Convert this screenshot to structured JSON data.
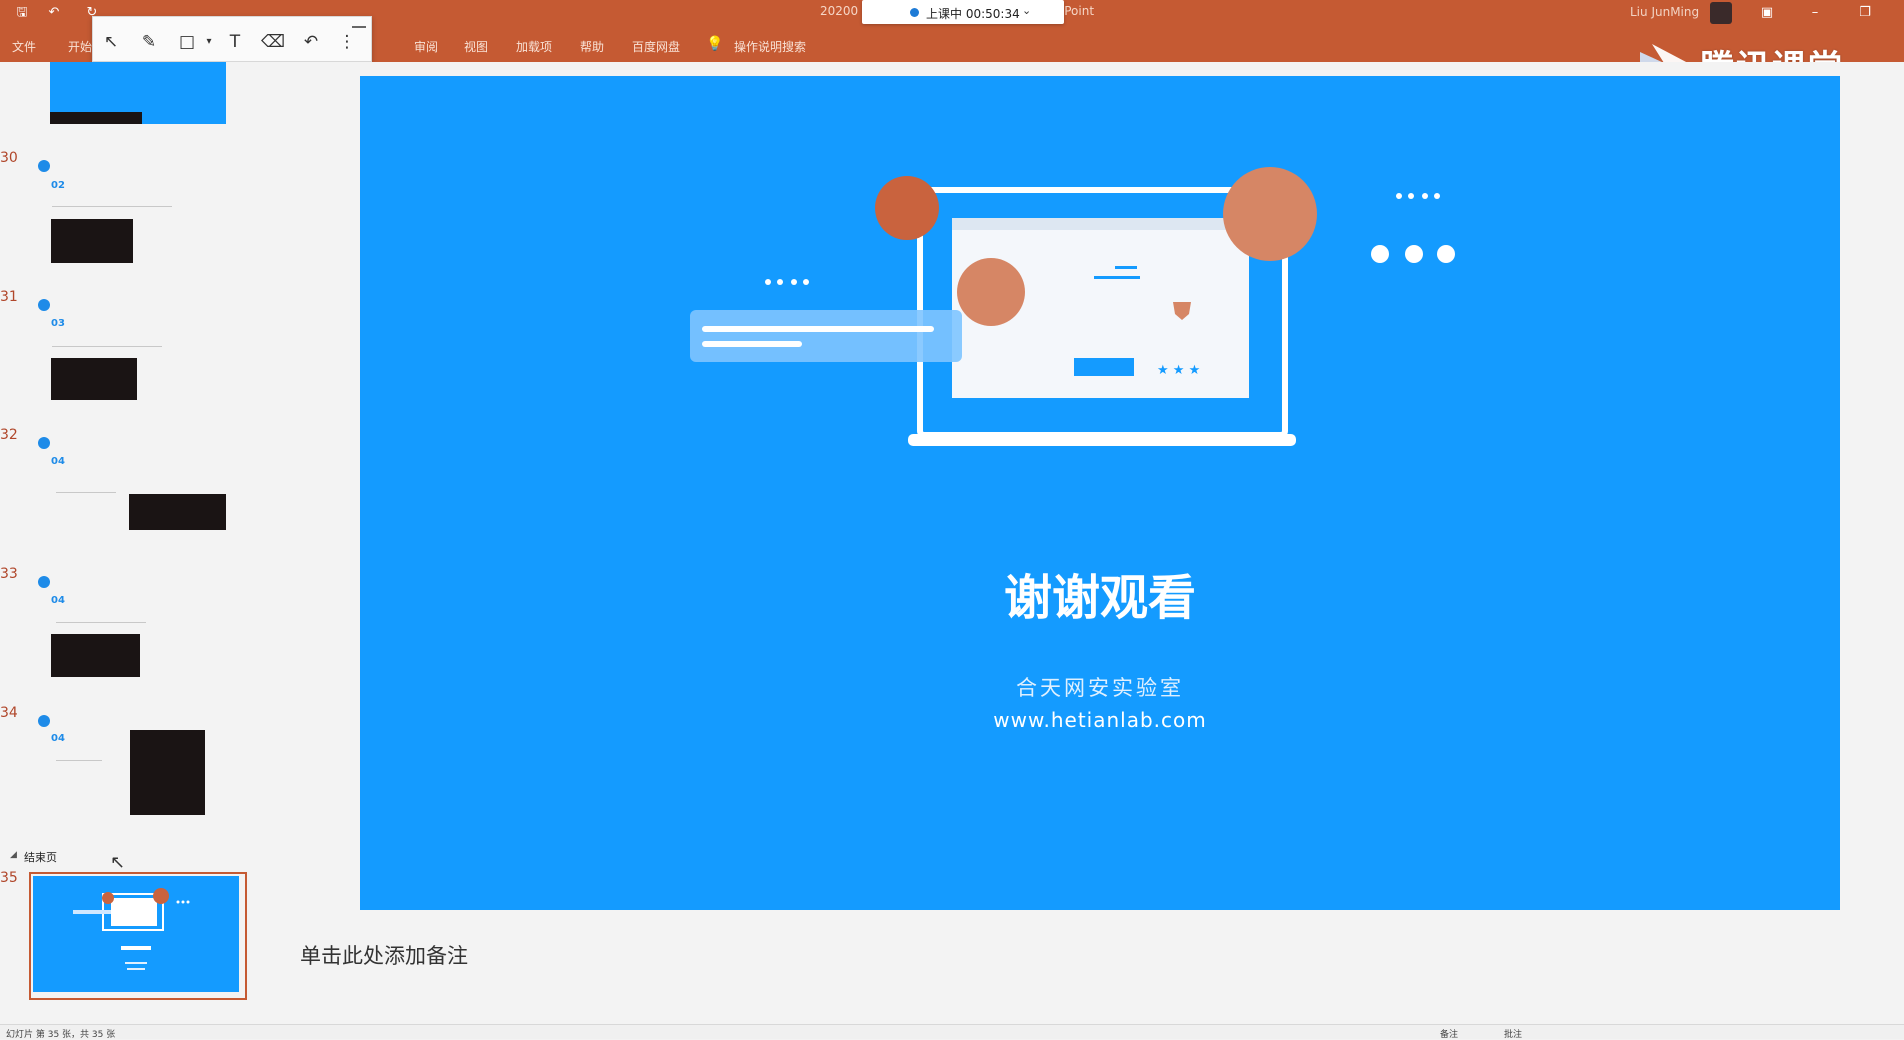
{
  "titlebar": {
    "doc_title": "20200",
    "doc_title_app": "sPoint",
    "user_name": "Liu JunMing"
  },
  "live_class": {
    "status": "上课中 00:50:34"
  },
  "ribbon": {
    "tabs": [
      "文件",
      "开始",
      "审阅",
      "视图",
      "加载项",
      "帮助",
      "百度网盘",
      "操作说明搜索"
    ]
  },
  "watermark": {
    "brand_text": "腾讯课堂"
  },
  "thumbnails": {
    "numbers": [
      "30",
      "31",
      "32",
      "33",
      "34",
      "35"
    ],
    "sections": [
      "02",
      "03",
      "04",
      "04",
      "04"
    ],
    "section_label": "结束页"
  },
  "slide": {
    "title": "谢谢观看",
    "subtitle": "合天网安实验室",
    "url": "www.hetianlab.com"
  },
  "notes": {
    "placeholder": "单击此处添加备注"
  },
  "statusbar": {
    "left_text": "幻灯片 第 35 张，共 35 张",
    "notes_label": "备注",
    "comments_label": "批注"
  },
  "colors": {
    "accent": "#c55a33",
    "slide_blue": "#149bff",
    "circle_orange": "#c9633e"
  }
}
